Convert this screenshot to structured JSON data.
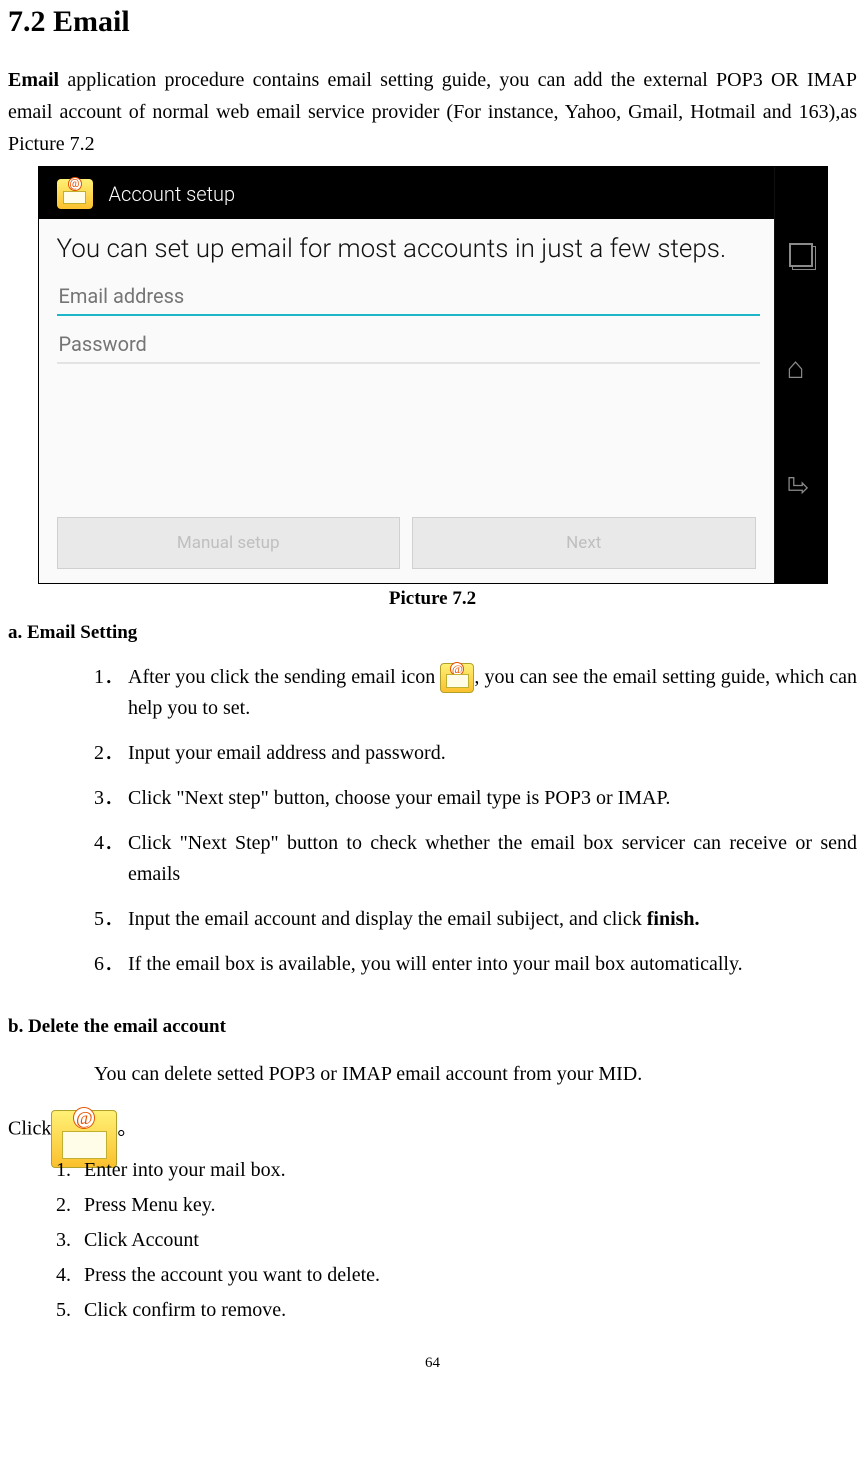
{
  "heading": "7.2 Email",
  "intro": {
    "bold_lead": "Email",
    "rest": " application procedure contains email setting guide, you can add the external POP3 OR IMAP email account of normal web email service provider (For instance, Yahoo, Gmail, Hotmail and 163),as Picture 7.2"
  },
  "screenshot": {
    "titlebar": "Account setup",
    "headline": "You can set up email for most accounts in just a few steps.",
    "input_email_placeholder": "Email address",
    "input_password_placeholder": "Password",
    "btn_manual": "Manual setup",
    "btn_next": "Next"
  },
  "pic_caption": "Picture 7.2",
  "sec_a_heading": "a. Email Setting",
  "steps_a": [
    {
      "pre": "After you click the sending email icon ",
      "post": ", you can see the email setting guide, which can help you to set."
    },
    {
      "text": "Input your email address and password."
    },
    {
      "text": "Click \"Next step\" button, choose your email type is POP3 or IMAP."
    },
    {
      "text": "Click \"Next Step\" button to check whether the email box servicer can receive or send emails"
    },
    {
      "pre": "Input the email account and display the email subiject, and click ",
      "bold": "finish."
    },
    {
      "text": "If the email box is available, you will enter into your mail box automatically."
    }
  ],
  "sec_b_heading": "b. Delete the email account",
  "sec_b_para": "You can delete setted POP3 or IMAP email account from your MID.",
  "click_lead": "Click",
  "click_tail": "。",
  "steps_b": [
    "Enter into your mail box.",
    "Press Menu key.",
    "Click Account",
    "Press the account you want to delete.",
    "Click confirm to remove."
  ],
  "page_number": "64"
}
